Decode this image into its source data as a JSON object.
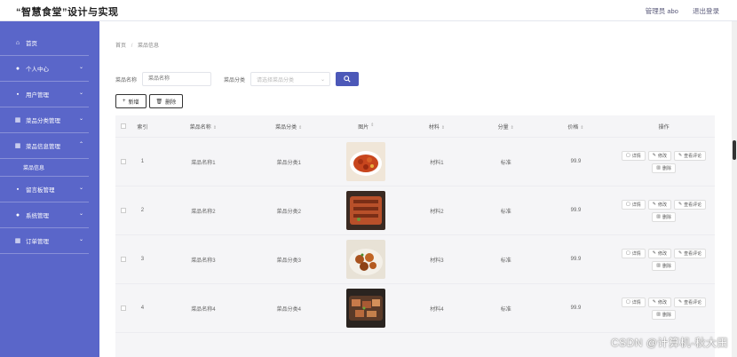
{
  "header": {
    "title": "“智慧食堂”设计与实现",
    "admin_label": "管理员 abo",
    "logout_label": "退出登录"
  },
  "sidebar": {
    "items": [
      {
        "label": "首页",
        "icon": "home-icon"
      },
      {
        "label": "个人中心",
        "icon": "user-icon"
      },
      {
        "label": "用户管理",
        "icon": "folder-icon"
      },
      {
        "label": "菜品分类管理",
        "icon": "grid-icon"
      },
      {
        "label": "菜品信息管理",
        "icon": "grid-icon",
        "sub": "菜品信息"
      },
      {
        "label": "留言板管理",
        "icon": "folder-icon"
      },
      {
        "label": "系统管理",
        "icon": "user-icon"
      },
      {
        "label": "订单管理",
        "icon": "grid-icon"
      }
    ]
  },
  "breadcrumb": {
    "home": "首页",
    "separator": "/",
    "current": "菜品信息"
  },
  "search": {
    "name_label": "菜品名称",
    "name_placeholder": "菜品名称",
    "category_label": "菜品分类",
    "category_placeholder": "请选择菜品分类",
    "search_icon": "search-icon"
  },
  "toolbar": {
    "add_label": "新增",
    "delete_label": "删除"
  },
  "table": {
    "columns": {
      "index": "索引",
      "name": "菜品名称",
      "category": "菜品分类",
      "image": "图片",
      "material": "材料",
      "spec": "分量",
      "price": "价格",
      "ops": "操作"
    },
    "ops": {
      "detail": "详情",
      "edit": "修改",
      "review": "查看评论",
      "delete": "删除"
    },
    "rows": [
      {
        "index": "1",
        "name": "菜品名称1",
        "category": "菜品分类1",
        "material": "材料1",
        "spec": "标准",
        "price": "99.9"
      },
      {
        "index": "2",
        "name": "菜品名称2",
        "category": "菜品分类2",
        "material": "材料2",
        "spec": "标准",
        "price": "99.9"
      },
      {
        "index": "3",
        "name": "菜品名称3",
        "category": "菜品分类3",
        "material": "材料3",
        "spec": "标准",
        "price": "99.9"
      },
      {
        "index": "4",
        "name": "菜品名称4",
        "category": "菜品分类4",
        "material": "材料4",
        "spec": "标准",
        "price": "99.9"
      }
    ]
  },
  "watermark": "CSDN @计算机-秋大田",
  "colors": {
    "sidebar": "#5a66c9",
    "primary_button": "#4c58b8"
  }
}
